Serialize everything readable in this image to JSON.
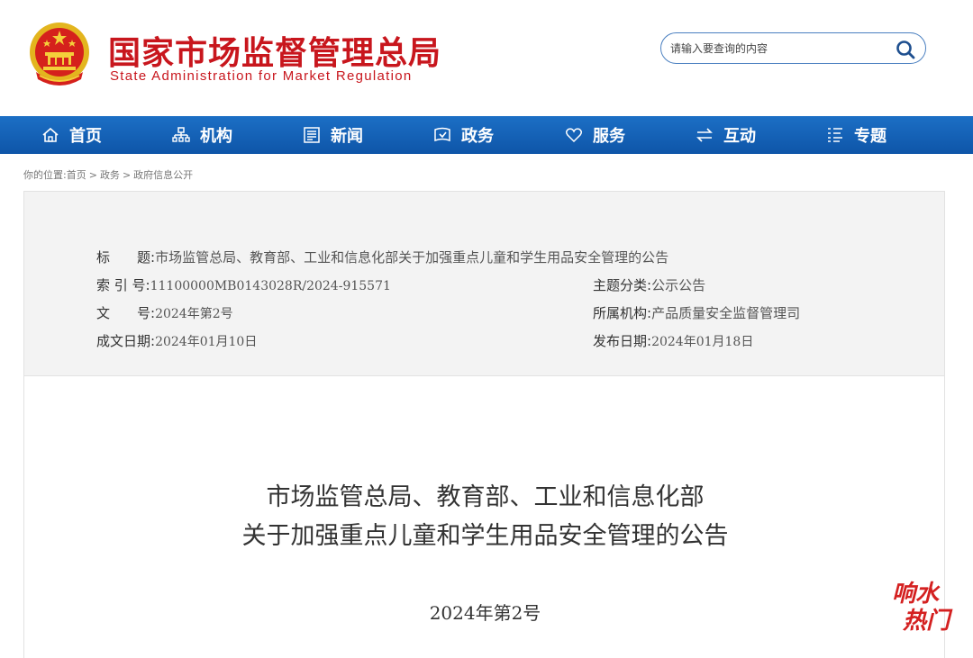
{
  "header": {
    "title_cn": "国家市场监督管理总局",
    "title_en": "State Administration for Market Regulation",
    "emblem": "national-emblem-icon"
  },
  "search": {
    "placeholder": "请输入要查询的内容",
    "icon": "search-icon"
  },
  "nav": {
    "items": [
      {
        "label": "首页",
        "icon": "home-icon"
      },
      {
        "label": "机构",
        "icon": "org-chart-icon"
      },
      {
        "label": "新闻",
        "icon": "newspaper-icon"
      },
      {
        "label": "政务",
        "icon": "government-icon"
      },
      {
        "label": "服务",
        "icon": "heart-icon"
      },
      {
        "label": "互动",
        "icon": "exchange-icon"
      },
      {
        "label": "专题",
        "icon": "list-icon"
      }
    ],
    "background": "#1565b8"
  },
  "breadcrumb": {
    "prefix": "你的位置:",
    "items": [
      "首页",
      "政务",
      "政府信息公开"
    ],
    "separator": ">"
  },
  "meta": {
    "title_label": "标　　题:",
    "title_value": "市场监管总局、教育部、工业和信息化部关于加强重点儿童和学生用品安全管理的公告",
    "index_label": "索 引 号:",
    "index_value": "11100000MB0143028R/2024-915571",
    "topic_label": "主题分类:",
    "topic_value": "公示公告",
    "docno_label": "文　　号:",
    "docno_value": "2024年第2号",
    "org_label": "所属机构:",
    "org_value": "产品质量安全监督管理司",
    "created_label": "成文日期:",
    "created_value": "2024年01月10日",
    "published_label": "发布日期:",
    "published_value": "2024年01月18日"
  },
  "article": {
    "title_line1": "市场监管总局、教育部、工业和信息化部",
    "title_line2": "关于加强重点儿童和学生用品安全管理的公告",
    "doc_number": "2024年第2号"
  },
  "watermark": {
    "text_line1": "响水",
    "text_line2": "热门",
    "color": "#d42020"
  },
  "colors": {
    "brand_red": "#c8161d",
    "nav_blue": "#1565b8"
  }
}
